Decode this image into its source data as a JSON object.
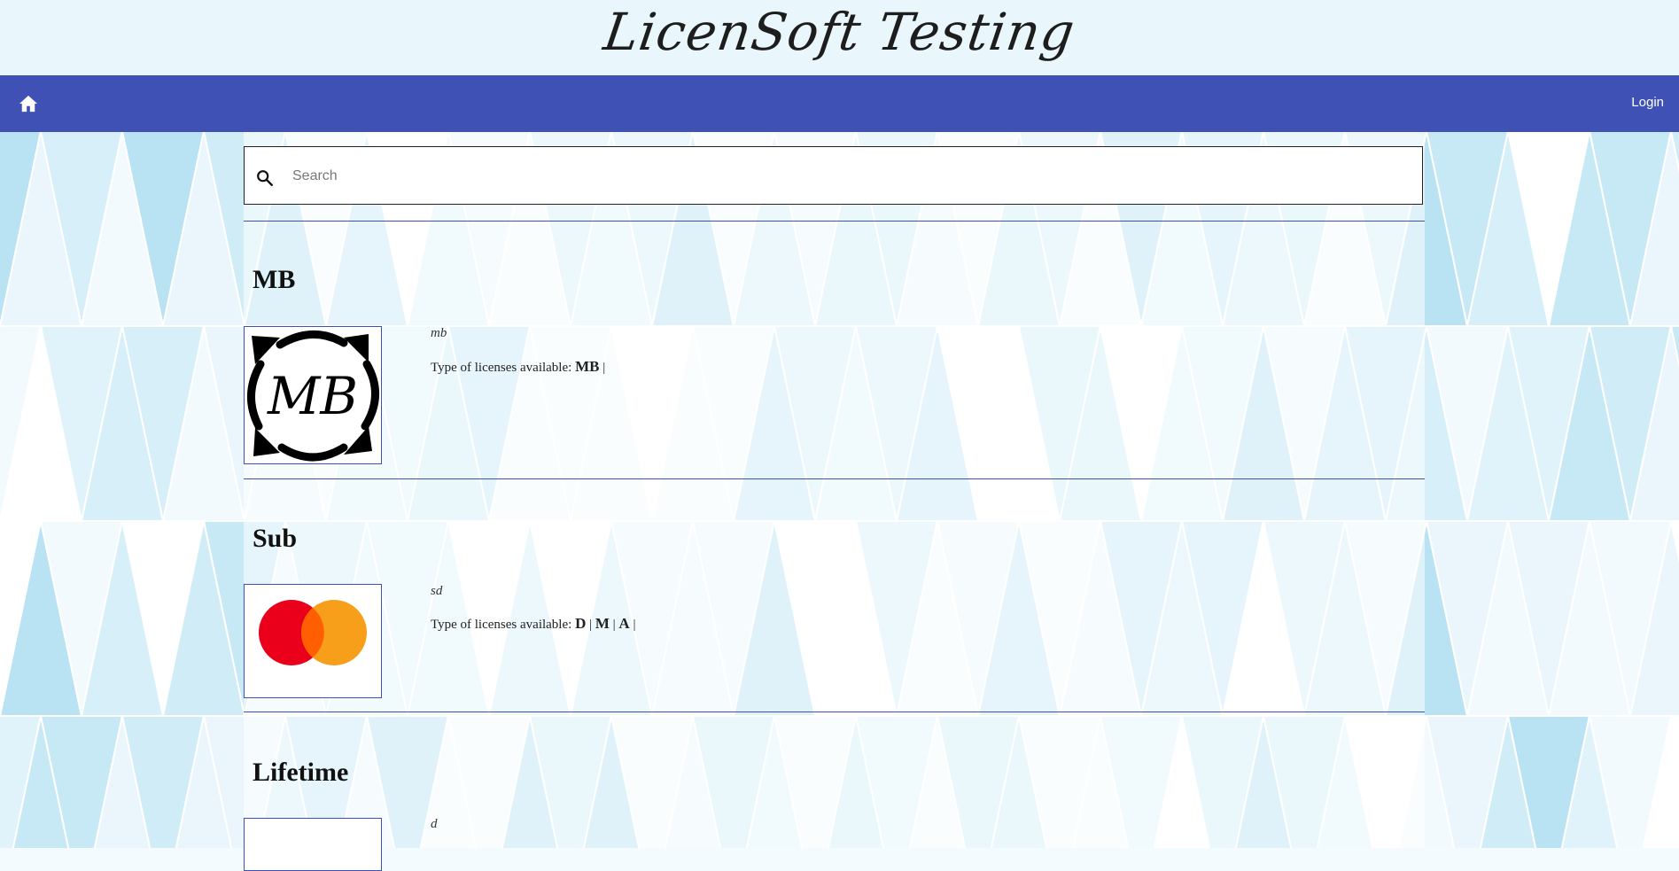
{
  "header": {
    "brand": "LicenSoft Testing"
  },
  "nav": {
    "login_label": "Login"
  },
  "search": {
    "placeholder": "Search",
    "value": ""
  },
  "products": [
    {
      "title": "MB",
      "description": "mb",
      "types_label": "Type of licenses available:",
      "types": [
        "MB"
      ],
      "logo": "mb-logo"
    },
    {
      "title": "Sub",
      "description": "sd",
      "types_label": "Type of licenses available:",
      "types": [
        "D",
        "M",
        "A"
      ],
      "logo": "mastercard-logo"
    },
    {
      "title": "Lifetime",
      "description": "d",
      "types_label": "Type of licenses available:",
      "types": [],
      "logo": ""
    }
  ],
  "colors": {
    "nav": "#3f51b5",
    "brand_bar": "#e9f6fc",
    "divider": "#3f51b5"
  }
}
